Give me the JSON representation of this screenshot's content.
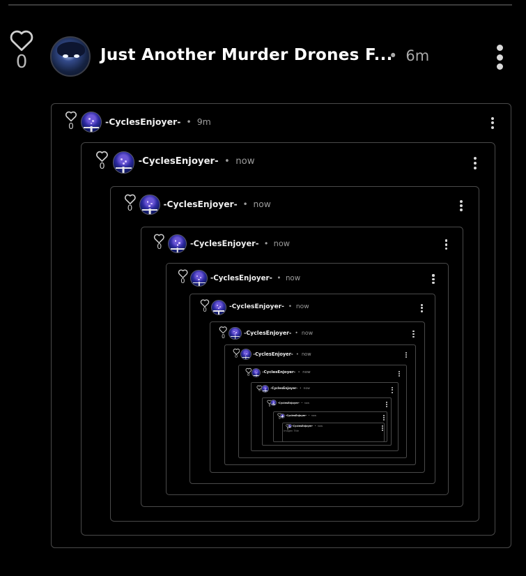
{
  "post": {
    "likes": "0",
    "title": "Just Another Murder Drones F...",
    "separator": "•",
    "time": "6m"
  },
  "nested": {
    "username": "-CyclesEnjoyer-",
    "separator": "•",
    "first_time": "9m",
    "later_time": "now",
    "likes": "0",
    "depth": 13,
    "inner_note": "Imagen Title"
  },
  "icons": {
    "like": "heart-outline-icon",
    "menu": "more-vertical-icon"
  },
  "colors": {
    "background": "#000000",
    "border": "#4a4a4a",
    "text": "#ffffff",
    "muted": "#a9a9a9"
  }
}
